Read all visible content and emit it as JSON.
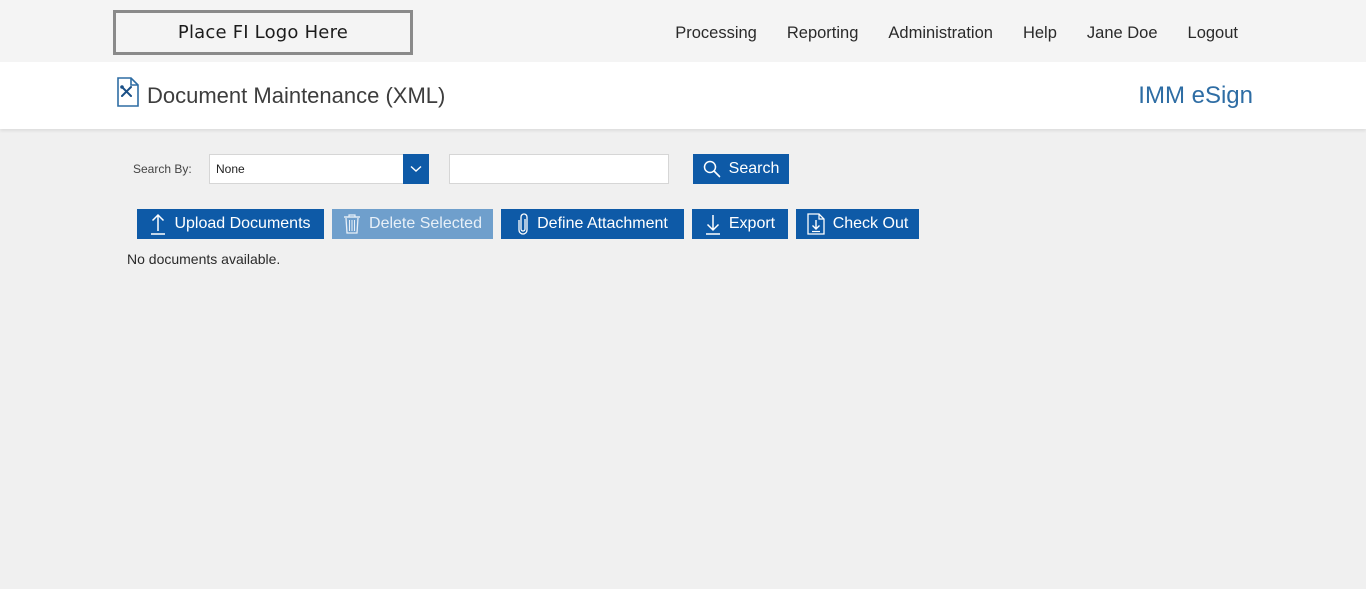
{
  "header": {
    "logo_text": "Place FI Logo Here",
    "nav": [
      "Processing",
      "Reporting",
      "Administration",
      "Help",
      "Jane Doe",
      "Logout"
    ]
  },
  "page": {
    "title": "Document Maintenance (XML)",
    "brand": "IMM eSign"
  },
  "search": {
    "label": "Search By:",
    "selected": "None",
    "input_value": "",
    "button_label": "Search"
  },
  "toolbar": {
    "upload_label": "Upload Documents",
    "delete_label": "Delete Selected",
    "attach_label": "Define Attachment",
    "export_label": "Export",
    "checkout_label": "Check Out"
  },
  "content": {
    "empty_message": "No documents available."
  },
  "colors": {
    "primary": "#0e5aa7",
    "disabled": "#6f9fcc",
    "brand_text": "#2e6da4",
    "background": "#f0f0f0"
  },
  "icons": {
    "upload": "upload-arrow-icon",
    "delete": "trash-icon",
    "attach": "paperclip-icon",
    "export": "download-arrow-icon",
    "checkout": "document-download-icon",
    "search": "magnifier-icon",
    "page": "document-tools-icon",
    "dropdown": "chevron-down-icon"
  }
}
